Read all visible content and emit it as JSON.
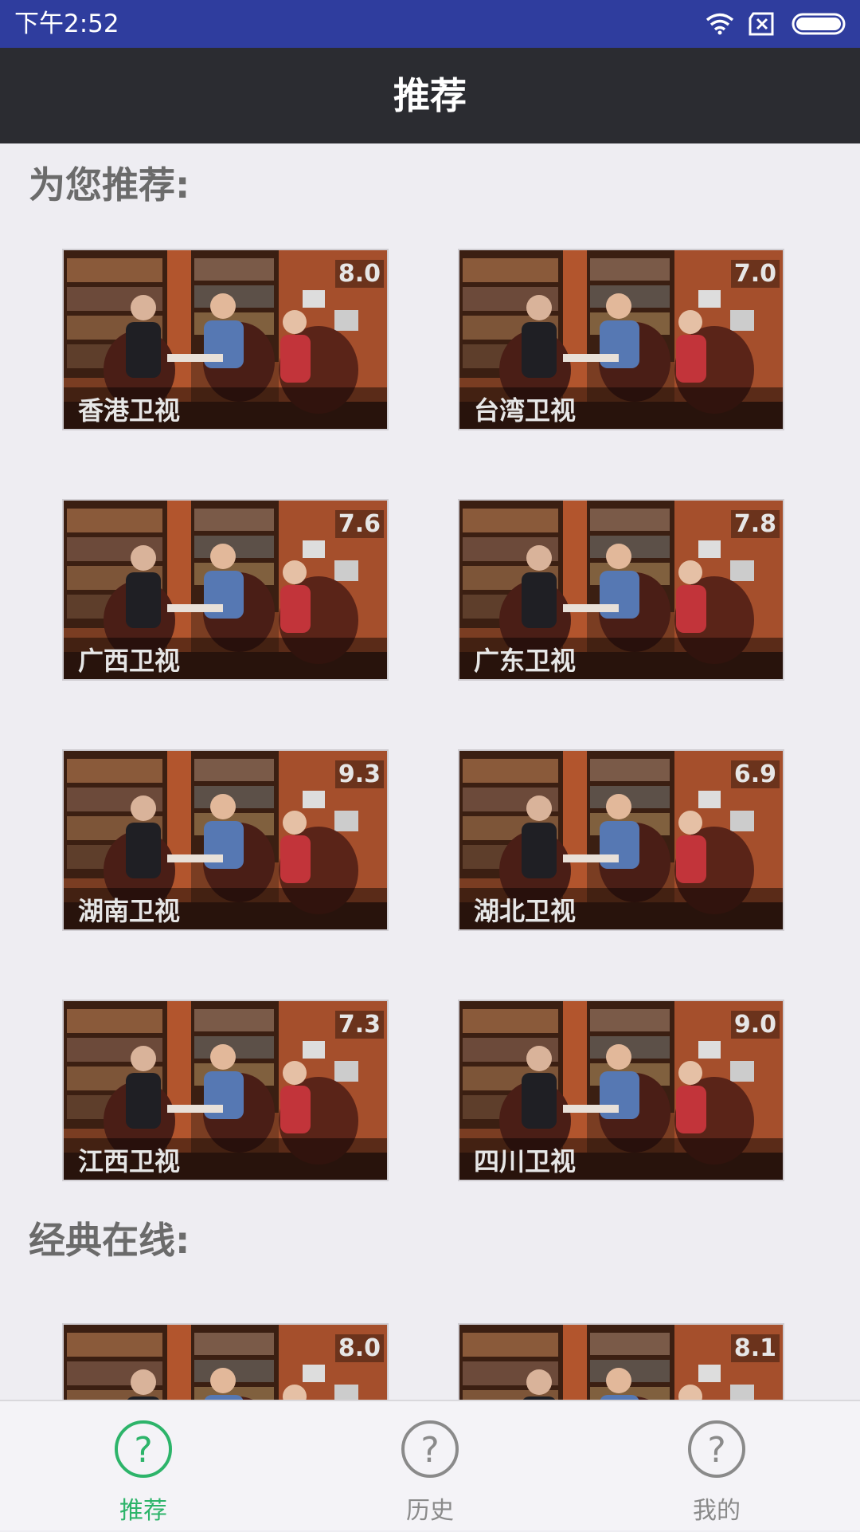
{
  "status": {
    "time": "下午2:52"
  },
  "header": {
    "title": "推荐"
  },
  "sections": [
    {
      "title": "为您推荐:"
    },
    {
      "title": "经典在线:"
    }
  ],
  "channels": [
    {
      "name": "香港卫视",
      "rating": "8.0"
    },
    {
      "name": "台湾卫视",
      "rating": "7.0"
    },
    {
      "name": "广西卫视",
      "rating": "7.6"
    },
    {
      "name": "广东卫视",
      "rating": "7.8"
    },
    {
      "name": "湖南卫视",
      "rating": "9.3"
    },
    {
      "name": "湖北卫视",
      "rating": "6.9"
    },
    {
      "name": "江西卫视",
      "rating": "7.3"
    },
    {
      "name": "四川卫视",
      "rating": "9.0"
    }
  ],
  "classics": [
    {
      "rating": "8.0"
    },
    {
      "rating": "8.1"
    }
  ],
  "tabs": [
    {
      "label": "推荐",
      "active": true
    },
    {
      "label": "历史",
      "active": false
    },
    {
      "label": "我的",
      "active": false
    }
  ],
  "colors": {
    "statusbar": "#2f3d9e",
    "appbar": "#2b2c31",
    "tab_active": "#2db46a",
    "tab_inactive": "#8a8a8a"
  }
}
